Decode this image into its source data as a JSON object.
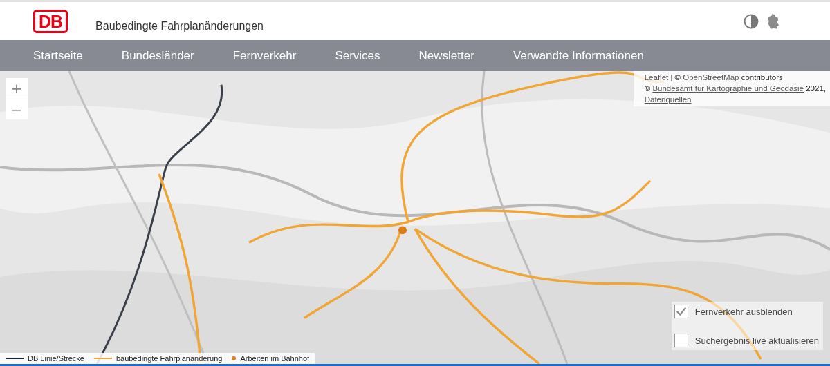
{
  "logo": "DB",
  "site_title": "Baubedingte Fahrplanänderungen",
  "nav": [
    {
      "label": "Startseite"
    },
    {
      "label": "Bundesländer"
    },
    {
      "label": "Fernverkehr"
    },
    {
      "label": "Services"
    },
    {
      "label": "Newsletter"
    },
    {
      "label": "Verwandte Informationen"
    }
  ],
  "map": {
    "kind": "picture",
    "zoom_buttons": [
      "+",
      "−"
    ],
    "attribution": [
      [
        {
          "text": "Leaflet",
          "link": true
        },
        {
          "text": " | © ",
          "link": false
        },
        {
          "text": "OpenStreetMap",
          "link": true
        },
        {
          "text": " contributors",
          "link": false
        }
      ],
      [
        {
          "text": "© ",
          "link": false
        },
        {
          "text": "Bundesamt für Kartographie und Geodäsie",
          "link": true
        },
        {
          "text": " 2021,",
          "link": false
        }
      ],
      [
        {
          "text": "Datenquellen",
          "link": true
        }
      ]
    ],
    "options": [
      {
        "label": "Fernverkehr ausblenden",
        "checked": true
      },
      {
        "label": "Suchergebnis live aktualisieren",
        "checked": false
      }
    ],
    "legend": [
      {
        "kind": "line",
        "label": "DB Linie/Strecke",
        "color": "#1e2430"
      },
      {
        "kind": "line",
        "label": "baubedingte Fahrplanänderung",
        "color": "#f0a637"
      },
      {
        "kind": "dot",
        "label": "Arbeiten im Bahnhof",
        "color": "#e07c16"
      }
    ]
  }
}
